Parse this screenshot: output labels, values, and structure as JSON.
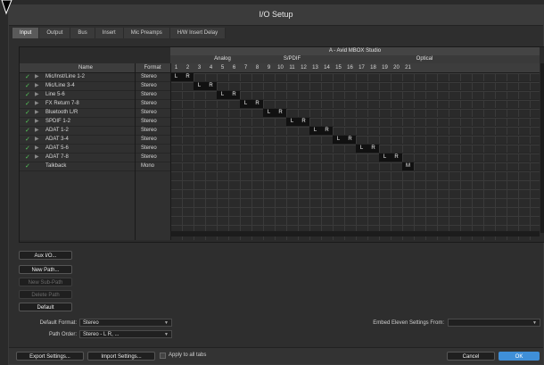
{
  "window": {
    "title": "I/O Setup"
  },
  "tabs": [
    "Input",
    "Output",
    "Bus",
    "Insert",
    "Mic Preamps",
    "H/W Insert Delay"
  ],
  "grid": {
    "device": "A - Avid MBOX Studio",
    "groups": [
      "Analog",
      "S/PDIF",
      "Optical"
    ],
    "col_name": "Name",
    "col_format": "Format",
    "channels": [
      "1",
      "2",
      "3",
      "4",
      "5",
      "6",
      "7",
      "8",
      "9",
      "10",
      "11",
      "12",
      "13",
      "14",
      "15",
      "16",
      "17",
      "18",
      "19",
      "20",
      "21"
    ],
    "rows": [
      {
        "check": "✓",
        "arrow": "▶",
        "name": "Mic/Inst/Line 1-2",
        "format": "Stereo"
      },
      {
        "check": "✓",
        "arrow": "▶",
        "name": "Mic/Line 3-4",
        "format": "Stereo"
      },
      {
        "check": "✓",
        "arrow": "▶",
        "name": "Line 5-6",
        "format": "Stereo"
      },
      {
        "check": "✓",
        "arrow": "▶",
        "name": "FX Return 7-8",
        "format": "Stereo"
      },
      {
        "check": "✓",
        "arrow": "▶",
        "name": "Bluetooth L/R",
        "format": "Stereo"
      },
      {
        "check": "✓",
        "arrow": "▶",
        "name": "SPDIF 1-2",
        "format": "Stereo"
      },
      {
        "check": "✓",
        "arrow": "▶",
        "name": "ADAT 1-2",
        "format": "Stereo"
      },
      {
        "check": "✓",
        "arrow": "▶",
        "name": "ADAT 3-4",
        "format": "Stereo"
      },
      {
        "check": "✓",
        "arrow": "▶",
        "name": "ADAT 5-6",
        "format": "Stereo"
      },
      {
        "check": "✓",
        "arrow": "▶",
        "name": "ADAT 7-8",
        "format": "Stereo"
      },
      {
        "check": "✓",
        "arrow": "",
        "name": "Talkback",
        "format": "Mono"
      }
    ],
    "assignments": [
      {
        "row": 0,
        "channel": 1,
        "label": "L"
      },
      {
        "row": 0,
        "channel": 2,
        "label": "R"
      },
      {
        "row": 1,
        "channel": 3,
        "label": "L"
      },
      {
        "row": 1,
        "channel": 4,
        "label": "R"
      },
      {
        "row": 2,
        "channel": 5,
        "label": "L"
      },
      {
        "row": 2,
        "channel": 6,
        "label": "R"
      },
      {
        "row": 3,
        "channel": 7,
        "label": "L"
      },
      {
        "row": 3,
        "channel": 8,
        "label": "R"
      },
      {
        "row": 4,
        "channel": 9,
        "label": "L"
      },
      {
        "row": 4,
        "channel": 10,
        "label": "R"
      },
      {
        "row": 5,
        "channel": 11,
        "label": "L"
      },
      {
        "row": 5,
        "channel": 12,
        "label": "R"
      },
      {
        "row": 6,
        "channel": 13,
        "label": "L"
      },
      {
        "row": 6,
        "channel": 14,
        "label": "R"
      },
      {
        "row": 7,
        "channel": 15,
        "label": "L"
      },
      {
        "row": 7,
        "channel": 16,
        "label": "R"
      },
      {
        "row": 8,
        "channel": 17,
        "label": "L"
      },
      {
        "row": 8,
        "channel": 18,
        "label": "R"
      },
      {
        "row": 9,
        "channel": 19,
        "label": "L"
      },
      {
        "row": 9,
        "channel": 20,
        "label": "R"
      },
      {
        "row": 10,
        "channel": 21,
        "label": "M"
      }
    ]
  },
  "buttons": {
    "aux_io": "Aux I/O...",
    "new_path": "New Path...",
    "new_sub_path": "New Sub-Path",
    "delete_path": "Delete Path",
    "default": "Default"
  },
  "settings": {
    "default_format_label": "Default Format:",
    "default_format_value": "Stereo",
    "path_order_label": "Path Order:",
    "path_order_value": "Stereo - L R, ...",
    "embed_label": "Embed Eleven Settings From:",
    "embed_value": ""
  },
  "footer": {
    "export": "Export Settings...",
    "import": "Import Settings...",
    "apply_all": "Apply to all tabs",
    "cancel": "Cancel",
    "ok": "OK"
  },
  "colors": {
    "accent": "#3f8fd8",
    "check": "#55c85a"
  }
}
